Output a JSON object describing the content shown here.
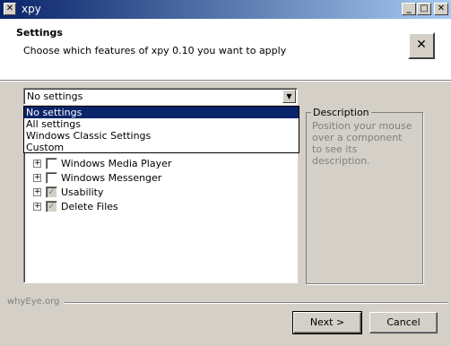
{
  "window": {
    "title": "xpy"
  },
  "header": {
    "title": "Settings",
    "subtitle": "Choose which features of xpy 0.10 you want to apply",
    "icon": "xpy-logo-icon"
  },
  "settings_combo": {
    "value": "No settings",
    "options": [
      "No settings",
      "All settings",
      "Windows Classic Settings",
      "Custom"
    ],
    "selected_index": 0
  },
  "tree": {
    "items": [
      {
        "label": "Windows Media Player",
        "checked": false,
        "grayed": false
      },
      {
        "label": "Windows Messenger",
        "checked": false,
        "grayed": false
      },
      {
        "label": "Usability",
        "checked": true,
        "grayed": true
      },
      {
        "label": "Delete Files",
        "checked": true,
        "grayed": true
      }
    ]
  },
  "description": {
    "title": "Description",
    "text": "Position your mouse over a component to see its description."
  },
  "footer": {
    "brand": "whyEye.org",
    "next_label": "Next >",
    "cancel_label": "Cancel"
  }
}
